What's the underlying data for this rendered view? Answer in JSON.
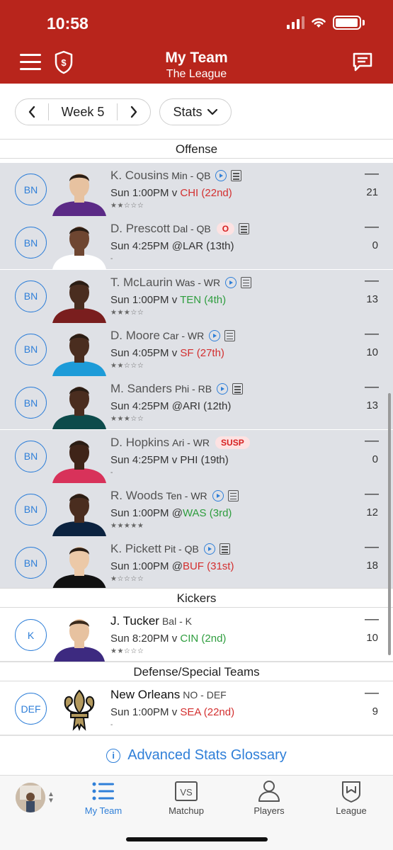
{
  "status_bar": {
    "time": "10:58"
  },
  "header": {
    "title": "My Team",
    "subtitle": "The League"
  },
  "controls": {
    "week_label": "Week 5",
    "stats_label": "Stats"
  },
  "sections": {
    "offense": "Offense",
    "kickers": "Kickers",
    "defense": "Defense/Special Teams"
  },
  "players": [
    {
      "slot": "BN",
      "name": "K. Cousins",
      "team_pos": "Min - QB",
      "game": "Sun 1:00PM v ",
      "opp": "CHI (22nd)",
      "opp_status": "bad",
      "stars": "★★☆☆☆",
      "points": "21",
      "dash": "—",
      "badge": "",
      "video": true,
      "note": true,
      "skin": "#e7c2a0",
      "jersey": "#5b2a86"
    },
    {
      "slot": "BN",
      "name": "D. Prescott",
      "team_pos": "Dal - QB",
      "game": "Sun 4:25PM @",
      "opp": "LAR (13th)",
      "opp_status": "neutral",
      "stars": "-",
      "points": "0",
      "dash": "—",
      "badge": "O",
      "video": false,
      "note": true,
      "skin": "#6e4631",
      "jersey": "#ffffff"
    },
    {
      "slot": "BN",
      "name": "T. McLaurin",
      "team_pos": "Was - WR",
      "game": "Sun 1:00PM v ",
      "opp": "TEN (4th)",
      "opp_status": "good",
      "stars": "★★★☆☆",
      "points": "13",
      "dash": "—",
      "badge": "",
      "video": true,
      "note": true,
      "skin": "#4a2d1f",
      "jersey": "#7a1e1e"
    },
    {
      "slot": "BN",
      "name": "D. Moore",
      "team_pos": "Car - WR",
      "game": "Sun 4:05PM v ",
      "opp": "SF (27th)",
      "opp_status": "bad",
      "stars": "★★☆☆☆",
      "points": "10",
      "dash": "—",
      "badge": "",
      "video": true,
      "note": true,
      "skin": "#4a2d1f",
      "jersey": "#1d9bd8"
    },
    {
      "slot": "BN",
      "name": "M. Sanders",
      "team_pos": "Phi - RB",
      "game": "Sun 4:25PM @",
      "opp": "ARI (12th)",
      "opp_status": "neutral",
      "stars": "★★★☆☆",
      "points": "13",
      "dash": "—",
      "badge": "",
      "video": true,
      "note": true,
      "skin": "#4a2d1f",
      "jersey": "#0d4b4b"
    },
    {
      "slot": "BN",
      "name": "D. Hopkins",
      "team_pos": "Ari - WR",
      "game": "Sun 4:25PM v ",
      "opp": "PHI (19th)",
      "opp_status": "neutral",
      "stars": "-",
      "points": "0",
      "dash": "—",
      "badge": "SUSP",
      "video": false,
      "note": false,
      "skin": "#3f2418",
      "jersey": "#d8325a"
    },
    {
      "slot": "BN",
      "name": "R. Woods",
      "team_pos": "Ten - WR",
      "game": "Sun 1:00PM @",
      "opp": "WAS (3rd)",
      "opp_status": "good",
      "stars": "★★★★★",
      "points": "12",
      "dash": "—",
      "badge": "",
      "video": true,
      "note": true,
      "skin": "#4a2d1f",
      "jersey": "#0c2340"
    },
    {
      "slot": "BN",
      "name": "K. Pickett",
      "team_pos": "Pit - QB",
      "game": "Sun 1:00PM @",
      "opp": "BUF (31st)",
      "opp_status": "bad",
      "stars": "★☆☆☆☆",
      "points": "18",
      "dash": "—",
      "badge": "",
      "video": true,
      "note": true,
      "skin": "#ecc9a8",
      "jersey": "#111111"
    }
  ],
  "kicker": {
    "slot": "K",
    "name": "J. Tucker",
    "team_pos": "Bal - K",
    "game": "Sun 8:20PM v ",
    "opp": "CIN (2nd)",
    "opp_status": "good",
    "stars": "★★☆☆☆",
    "points": "10",
    "dash": "—",
    "skin": "#e7c2a0",
    "jersey": "#3d2a80"
  },
  "defense": {
    "slot": "DEF",
    "name": "New Orleans",
    "team_pos": "NO - DEF",
    "game": "Sun 1:00PM v ",
    "opp": "SEA (22nd)",
    "opp_status": "bad",
    "stars": "-",
    "points": "9",
    "dash": "—"
  },
  "glossary": {
    "label": "Advanced Stats Glossary"
  },
  "bottom_nav": [
    {
      "label": "My Team",
      "icon": "list-icon",
      "active": true
    },
    {
      "label": "Matchup",
      "icon": "vs-icon",
      "active": false
    },
    {
      "label": "Players",
      "icon": "person-icon",
      "active": false
    },
    {
      "label": "League",
      "icon": "shield-icon",
      "active": false
    }
  ],
  "colors": {
    "header": "#b8251c",
    "accent": "#2f7fd8",
    "good": "#2e9d3e",
    "bad": "#d32f2f",
    "bench_bg": "#dfe1e6"
  }
}
